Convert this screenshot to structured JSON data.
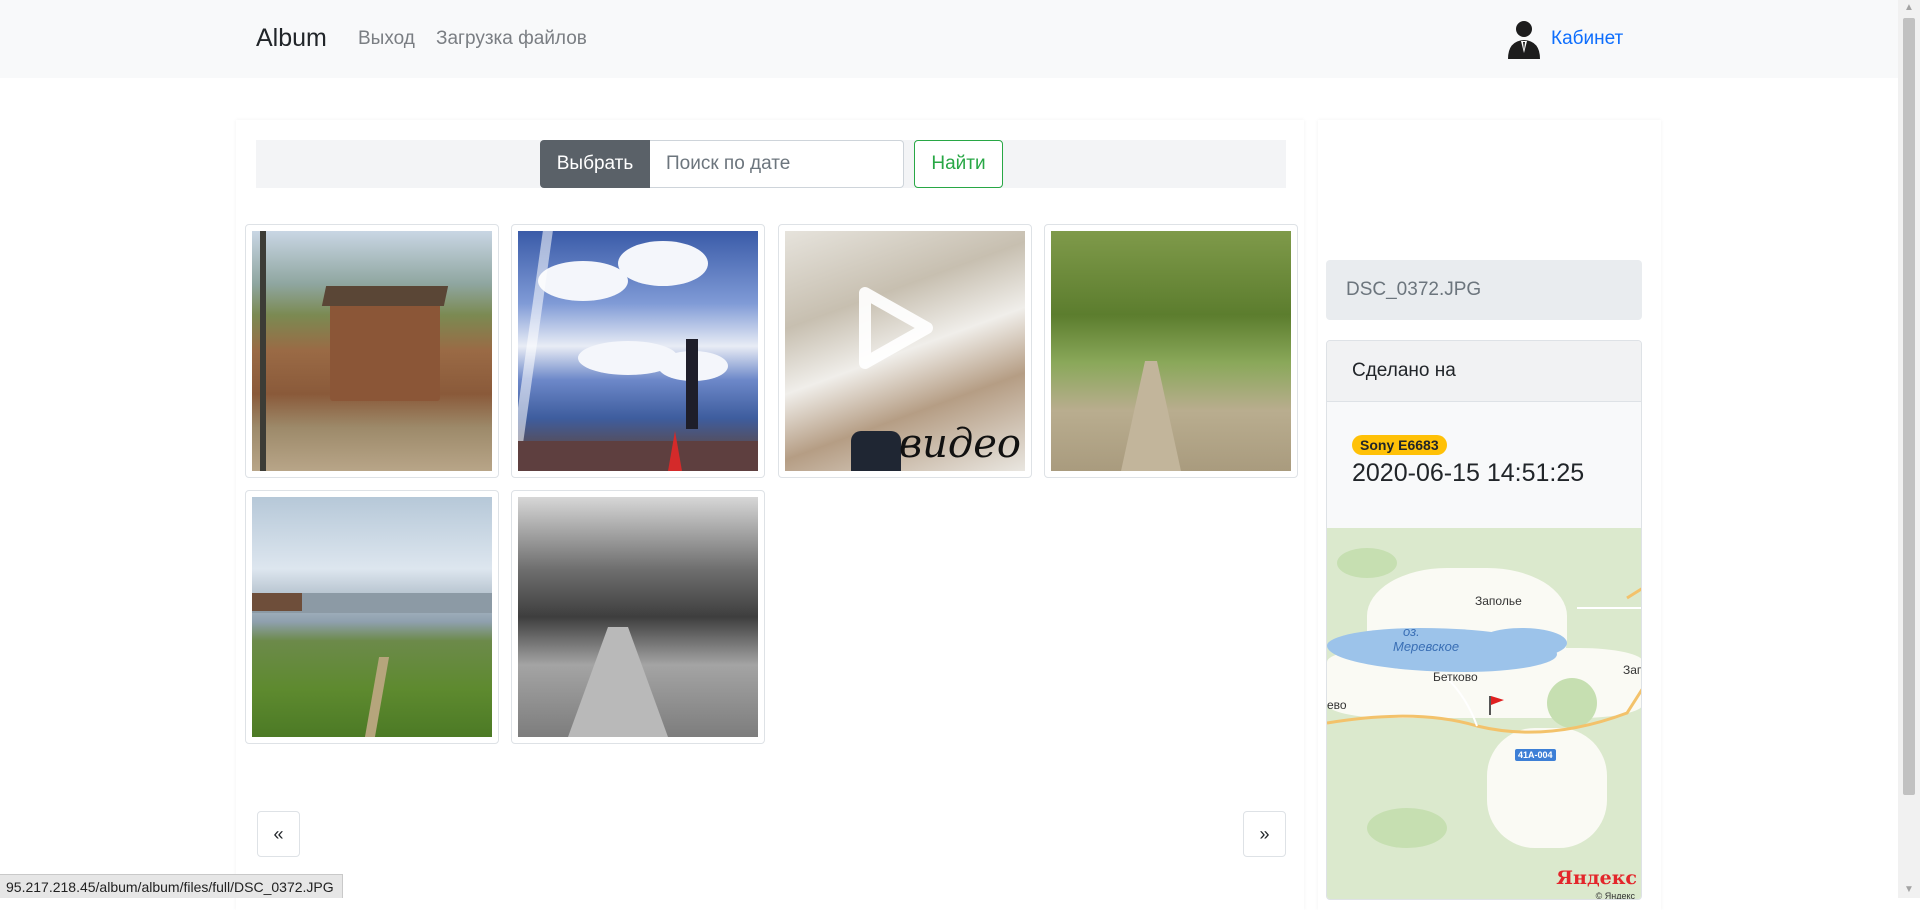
{
  "navbar": {
    "brand": "Album",
    "links": [
      "Выход",
      "Загрузка файлов"
    ],
    "cabinet_label": "Кабинет"
  },
  "search": {
    "select_label": "Выбрать",
    "date_placeholder": "Поиск по дате",
    "find_label": "Найти"
  },
  "gallery": {
    "video_overlay_text": "видео"
  },
  "pagination": {
    "prev": "«",
    "next": "»"
  },
  "details": {
    "filename": "DSC_0372.JPG",
    "header": "Сделано на",
    "device_badge": "Sony E6683",
    "datetime": "2020-06-15 14:51:25"
  },
  "map": {
    "labels": {
      "zapolye": "Заполье",
      "lake_prefix": "оз.",
      "lake_name": "Меревское",
      "betkovo": "Бетково",
      "left_cut": "ево",
      "right_cut": "Зап",
      "road": "41А-004"
    },
    "logo": "Яндекс",
    "copyright": "© Яндекс"
  },
  "status_bar": {
    "url": "95.217.218.45/album/album/files/full/DSC_0372.JPG"
  },
  "colors": {
    "link": "#0d6efd",
    "success": "#28a745",
    "badge": "#ffc107",
    "select_button": "#5a6168"
  }
}
